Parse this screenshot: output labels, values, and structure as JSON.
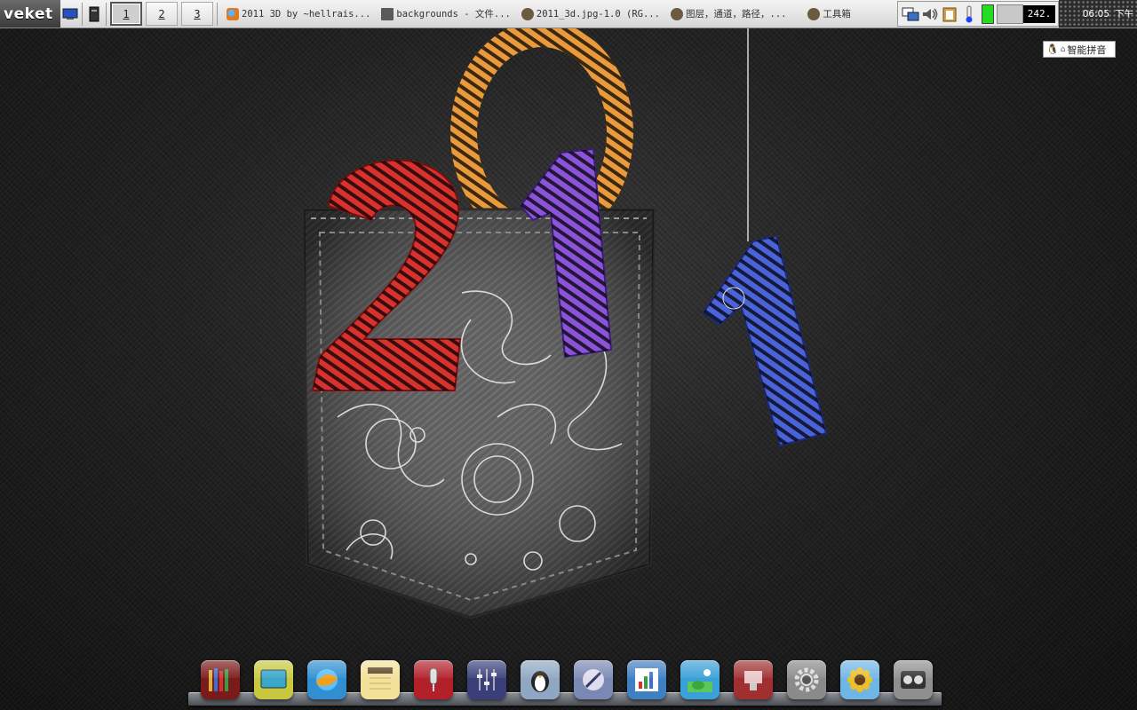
{
  "panel": {
    "brand": "veket",
    "workspaces": [
      {
        "label": "1",
        "active": true
      },
      {
        "label": "2",
        "active": false
      },
      {
        "label": "3",
        "active": false
      }
    ],
    "tasks": [
      {
        "label": "2011 3D by ~hellrais...",
        "icon": "firefox-icon",
        "color": "#e07a1f"
      },
      {
        "label": "backgrounds - 文件...",
        "icon": "file-manager-icon",
        "color": "#5a5a5a"
      },
      {
        "label": "2011_3d.jpg-1.0 (RG...",
        "icon": "gimp-icon",
        "color": "#6b5a3f"
      },
      {
        "label": "图层，通道，路径，...",
        "icon": "gimp-icon",
        "color": "#6b5a3f"
      },
      {
        "label": "工具箱",
        "icon": "gimp-icon",
        "color": "#6b5a3f"
      }
    ],
    "tray": {
      "cpu": "242.",
      "clock": "06:05",
      "ampm": "下午",
      "battery_color": "#22dd22"
    }
  },
  "ime": {
    "label": "智能拼音"
  },
  "wallpaper": {
    "digits": [
      "2",
      "0",
      "1",
      "1"
    ],
    "colors": {
      "two": "#d8322f",
      "zero": "#e99a3c",
      "one_a": "#8b54d8",
      "one_b": "#4a63d8"
    }
  },
  "dock": {
    "items": [
      {
        "name": "library-icon",
        "bg": "#7a1a1a"
      },
      {
        "name": "display-icon",
        "bg": "#4a7a8c"
      },
      {
        "name": "web-browser-icon",
        "bg": "#2f8fd0"
      },
      {
        "name": "notes-icon",
        "bg": "#f3e19a"
      },
      {
        "name": "microphone-icon",
        "bg": "#b2202a"
      },
      {
        "name": "mixer-icon",
        "bg": "#3a3f7a"
      },
      {
        "name": "penguin-icon",
        "bg": "#8fa7c2"
      },
      {
        "name": "pen-icon",
        "bg": "#7a89b3"
      },
      {
        "name": "chart-icon",
        "bg": "#3f7fc4"
      },
      {
        "name": "image-viewer-icon",
        "bg": "#3aa0d8"
      },
      {
        "name": "presentation-icon",
        "bg": "#a03030"
      },
      {
        "name": "settings-icon",
        "bg": "#8a8a8a"
      },
      {
        "name": "photo-icon",
        "bg": "#6fb6e6"
      },
      {
        "name": "media-player-icon",
        "bg": "#8f8f8f"
      }
    ]
  }
}
